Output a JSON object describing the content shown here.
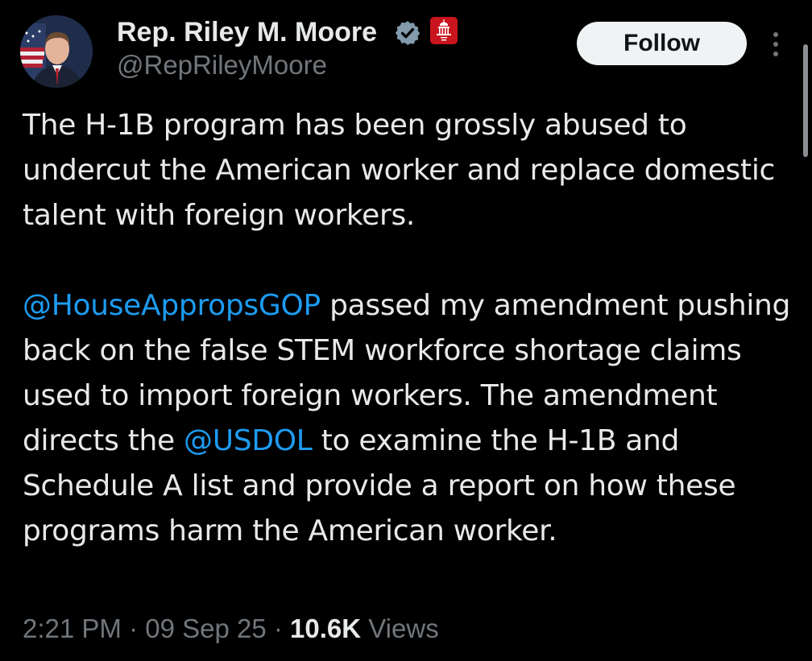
{
  "author": {
    "display_name": "Rep. Riley M. Moore",
    "handle": "@RepRileyMoore",
    "verified_icon": "verified-badge-icon",
    "affiliation_icon": "government-seal-icon"
  },
  "actions": {
    "follow_label": "Follow",
    "more_icon": "more-options-icon"
  },
  "tweet": {
    "paragraph1": "The H-1B program has been grossly abused to undercut the American worker and replace domestic talent with foreign workers.",
    "mention1": "@HouseAppropsGOP",
    "text2a": " passed my amendment pushing back on the false STEM workforce shortage claims used to import foreign workers. The amendment directs the ",
    "mention2": "@USDOL",
    "text2b": " to examine the H-1B and Schedule A list and provide a report on how these programs harm the American worker."
  },
  "meta": {
    "time": "2:21 PM",
    "separator": " · ",
    "date": "09 Sep 25",
    "views_count": "10.6K",
    "views_label": " Views"
  },
  "colors": {
    "background": "#000000",
    "text": "#e7e9ea",
    "muted": "#71767b",
    "link": "#1d9bf0",
    "verified": "#829aab",
    "gov_badge": "#c8141c"
  }
}
